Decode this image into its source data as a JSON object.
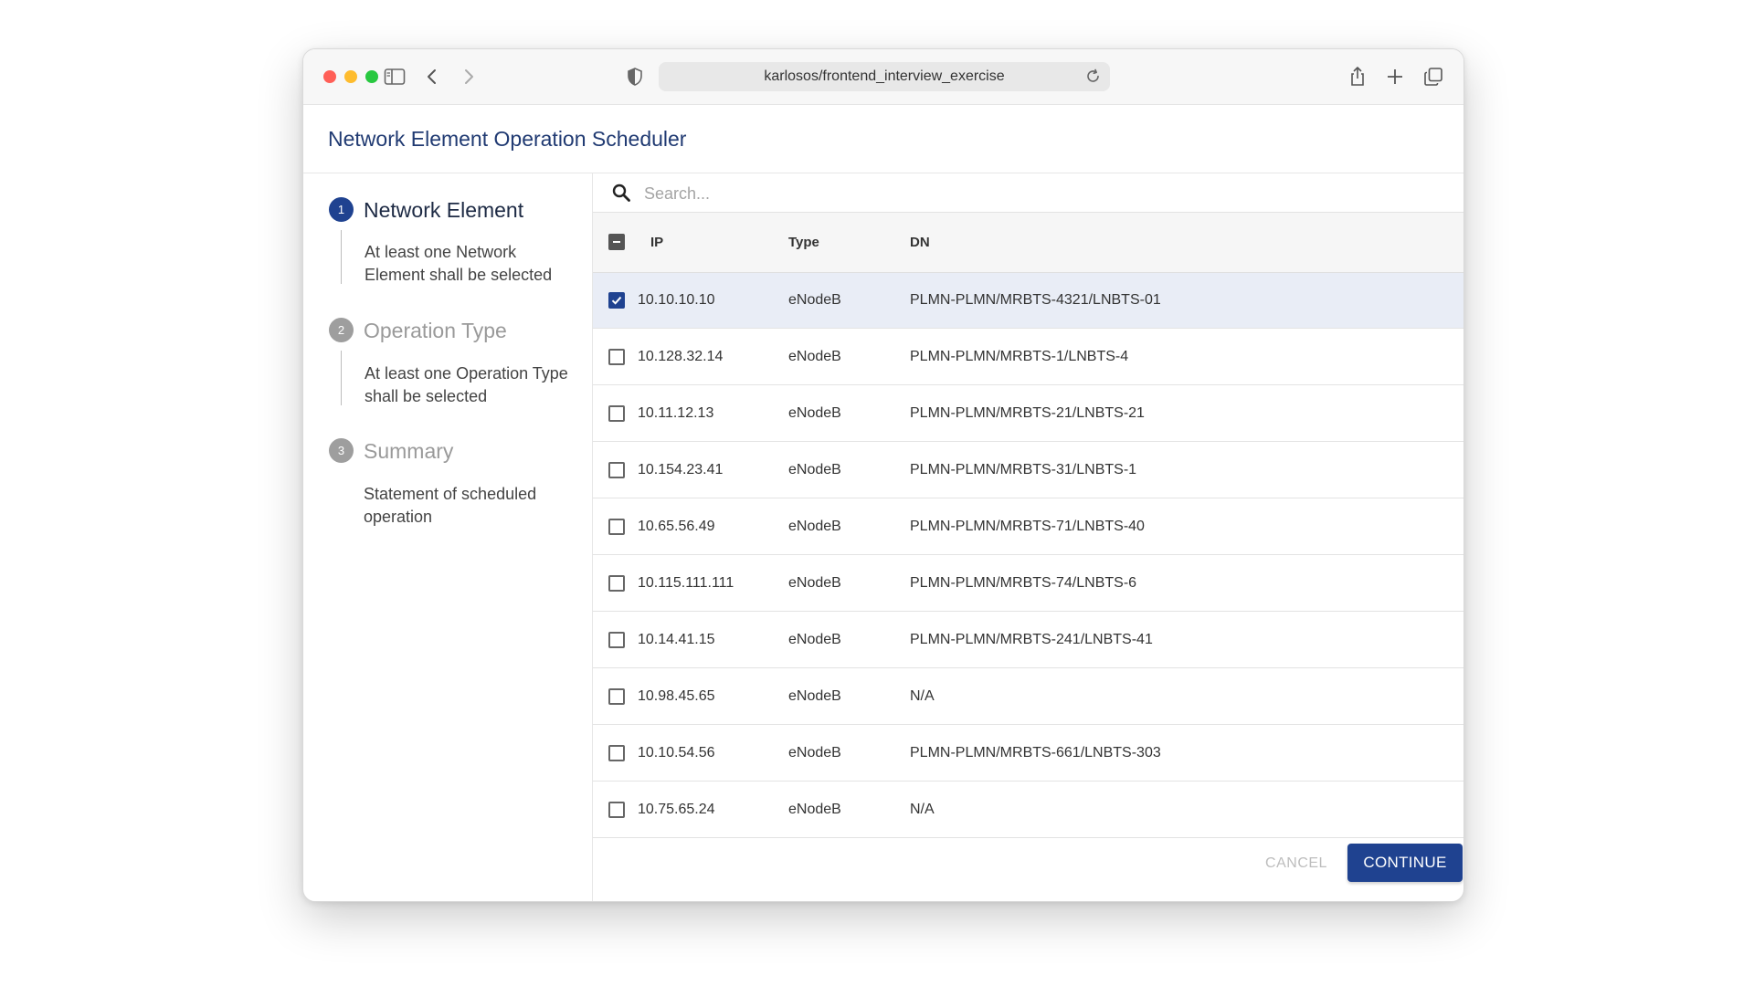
{
  "browser": {
    "url": "karlosos/frontend_interview_exercise"
  },
  "app": {
    "title": "Network Element Operation Scheduler"
  },
  "steps": [
    {
      "number": "1",
      "title": "Network Element",
      "description": "At least one Network Element shall be selected",
      "active": true
    },
    {
      "number": "2",
      "title": "Operation Type",
      "description": "At least one Operation Type shall be selected",
      "active": false
    },
    {
      "number": "3",
      "title": "Summary",
      "description": "Statement of scheduled operation",
      "active": false
    }
  ],
  "search": {
    "placeholder": "Search..."
  },
  "table": {
    "headers": {
      "ip": "IP",
      "type": "Type",
      "dn": "DN"
    },
    "select_all_state": "indeterminate",
    "rows": [
      {
        "ip": "10.10.10.10",
        "type": "eNodeB",
        "dn": "PLMN-PLMN/MRBTS-4321/LNBTS-01",
        "checked": true
      },
      {
        "ip": "10.128.32.14",
        "type": "eNodeB",
        "dn": "PLMN-PLMN/MRBTS-1/LNBTS-4",
        "checked": false
      },
      {
        "ip": "10.11.12.13",
        "type": "eNodeB",
        "dn": "PLMN-PLMN/MRBTS-21/LNBTS-21",
        "checked": false
      },
      {
        "ip": "10.154.23.41",
        "type": "eNodeB",
        "dn": "PLMN-PLMN/MRBTS-31/LNBTS-1",
        "checked": false
      },
      {
        "ip": "10.65.56.49",
        "type": "eNodeB",
        "dn": "PLMN-PLMN/MRBTS-71/LNBTS-40",
        "checked": false
      },
      {
        "ip": "10.115.111.111",
        "type": "eNodeB",
        "dn": "PLMN-PLMN/MRBTS-74/LNBTS-6",
        "checked": false
      },
      {
        "ip": "10.14.41.15",
        "type": "eNodeB",
        "dn": "PLMN-PLMN/MRBTS-241/LNBTS-41",
        "checked": false
      },
      {
        "ip": "10.98.45.65",
        "type": "eNodeB",
        "dn": "N/A",
        "checked": false
      },
      {
        "ip": "10.10.54.56",
        "type": "eNodeB",
        "dn": "PLMN-PLMN/MRBTS-661/LNBTS-303",
        "checked": false
      },
      {
        "ip": "10.75.65.24",
        "type": "eNodeB",
        "dn": "N/A",
        "checked": false
      }
    ]
  },
  "actions": {
    "cancel_label": "CANCEL",
    "continue_label": "CONTINUE"
  },
  "colors": {
    "primary": "#1f4290",
    "selected_row": "#e9edf6",
    "inactive_step": "#9e9e9e"
  }
}
